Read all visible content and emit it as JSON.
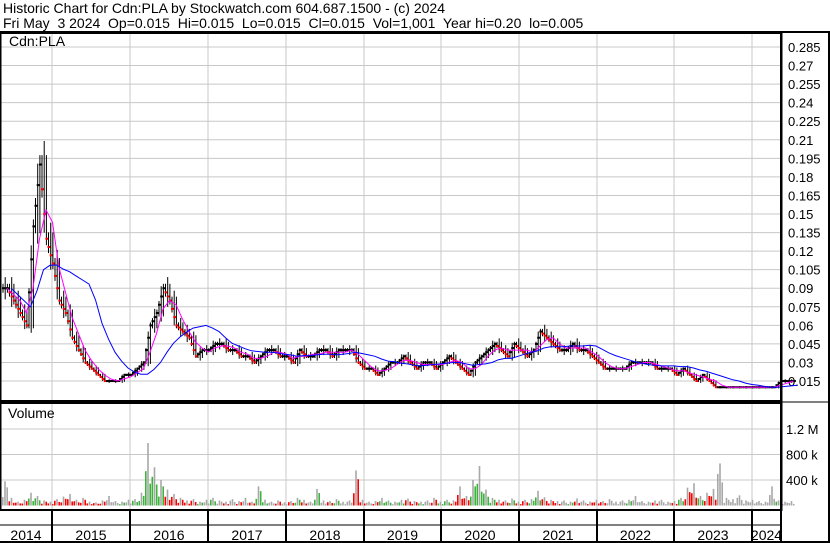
{
  "header": {
    "title": "Historic Chart for Cdn:PLA by Stockwatch.com 604.687.1500 - (c) 2024",
    "quote": "Fri May  3 2024  Op=0.015  Hi=0.015  Lo=0.015  Cl=0.015  Vol=1,001  Year hi=0.20  lo=0.005"
  },
  "chart_data": {
    "type": "bar",
    "symbol_label": "Cdn:PLA",
    "volume_label": "Volume",
    "price_ticks": [
      "0.285",
      "0.27",
      "0.255",
      "0.24",
      "0.225",
      "0.21",
      "0.195",
      "0.18",
      "0.165",
      "0.15",
      "0.135",
      "0.12",
      "0.105",
      "0.09",
      "0.075",
      "0.06",
      "0.045",
      "0.03",
      "0.015"
    ],
    "ylim": [
      0.0,
      0.295
    ],
    "volume_ticks": [
      "1.2 M",
      "800 k",
      "400 k"
    ],
    "volume_tick_values": [
      1200,
      800,
      400
    ],
    "years": [
      "2014",
      "2015",
      "2016",
      "2017",
      "2018",
      "2019",
      "2020",
      "2021",
      "2022",
      "2023",
      "2024"
    ],
    "start_month": "2014-04",
    "monthly_close": [
      0.09,
      0.08,
      0.07,
      0.06,
      0.14,
      0.19,
      0.13,
      0.11,
      0.08,
      0.07,
      0.05,
      0.04,
      0.03,
      0.025,
      0.02,
      0.015,
      0.015,
      0.015,
      0.02,
      0.02,
      0.025,
      0.03,
      0.06,
      0.07,
      0.09,
      0.08,
      0.06,
      0.055,
      0.05,
      0.035,
      0.04,
      0.04,
      0.045,
      0.045,
      0.04,
      0.04,
      0.035,
      0.035,
      0.03,
      0.035,
      0.04,
      0.04,
      0.035,
      0.035,
      0.03,
      0.04,
      0.035,
      0.035,
      0.04,
      0.04,
      0.035,
      0.04,
      0.04,
      0.04,
      0.03,
      0.025,
      0.025,
      0.02,
      0.025,
      0.03,
      0.03,
      0.035,
      0.03,
      0.025,
      0.03,
      0.03,
      0.025,
      0.03,
      0.035,
      0.03,
      0.025,
      0.02,
      0.03,
      0.035,
      0.04,
      0.045,
      0.04,
      0.035,
      0.045,
      0.04,
      0.035,
      0.04,
      0.055,
      0.05,
      0.045,
      0.04,
      0.04,
      0.045,
      0.04,
      0.04,
      0.035,
      0.03,
      0.025,
      0.025,
      0.025,
      0.025,
      0.03,
      0.03,
      0.03,
      0.03,
      0.025,
      0.025,
      0.025,
      0.02,
      0.025,
      0.02,
      0.015,
      0.02,
      0.015,
      0.01,
      0.01,
      0.01,
      0.01,
      0.01,
      0.01,
      0.01,
      0.01,
      0.01,
      0.01,
      0.015,
      0.015,
      0.015
    ],
    "monthly_volume_k": [
      380,
      120,
      60,
      90,
      200,
      150,
      80,
      60,
      100,
      140,
      180,
      90,
      120,
      60,
      50,
      80,
      150,
      70,
      60,
      90,
      100,
      200,
      980,
      600,
      400,
      250,
      180,
      120,
      80,
      100,
      60,
      90,
      120,
      80,
      60,
      100,
      70,
      120,
      60,
      300,
      90,
      60,
      80,
      50,
      70,
      120,
      90,
      60,
      260,
      80,
      70,
      100,
      60,
      80,
      550,
      90,
      60,
      70,
      120,
      80,
      60,
      90,
      110,
      70,
      60,
      80,
      120,
      60,
      90,
      80,
      300,
      150,
      400,
      620,
      250,
      120,
      90,
      80,
      110,
      60,
      90,
      100,
      230,
      130,
      90,
      70,
      80,
      60,
      110,
      80,
      60,
      90,
      70,
      100,
      60,
      80,
      90,
      150,
      70,
      60,
      80,
      90,
      60,
      70,
      120,
      280,
      350,
      150,
      200,
      260,
      660,
      120,
      100,
      160,
      80,
      90,
      70,
      60,
      300,
      80,
      60,
      70
    ],
    "colors": {
      "up": "#3cb43c",
      "down": "#ff0000",
      "flat": "#a8a8a8",
      "ma_short": "#ff00ff",
      "ma_long": "#0000ff",
      "grid": "#c8c8c8"
    }
  }
}
